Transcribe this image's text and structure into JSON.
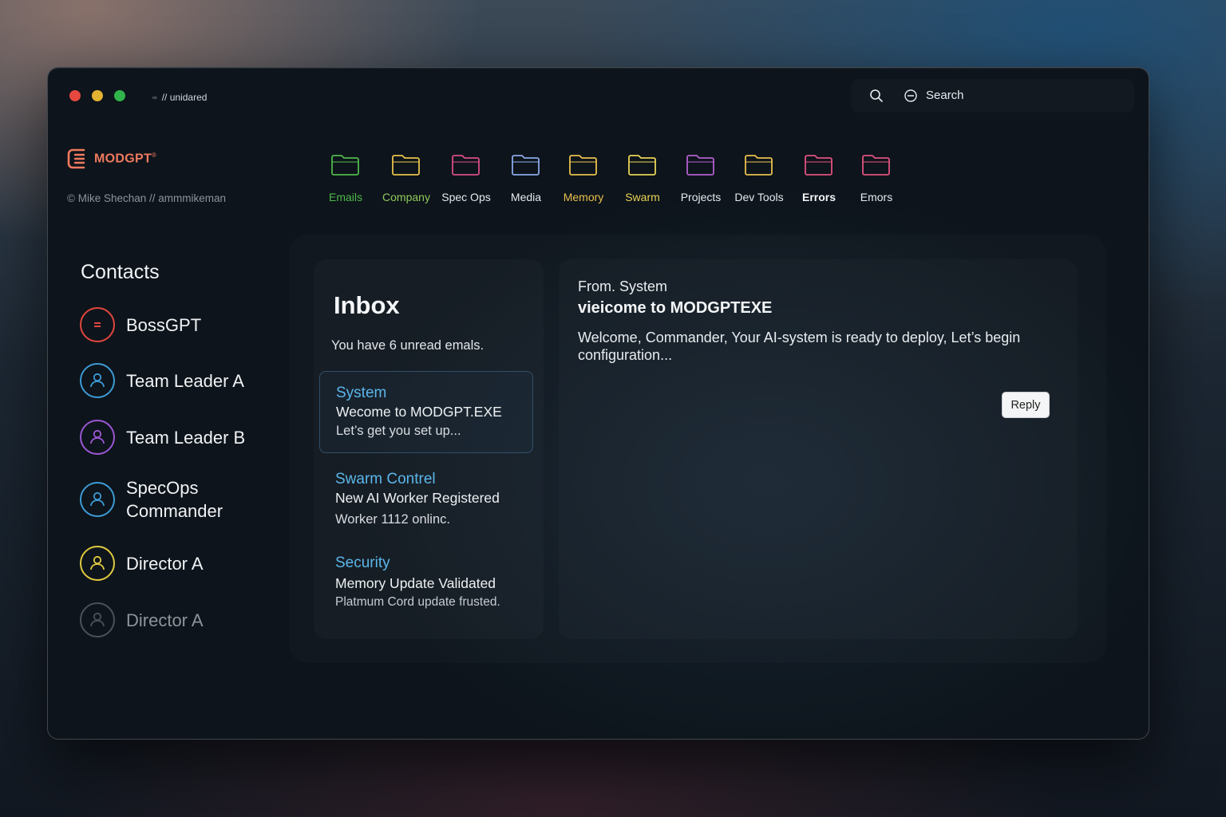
{
  "window": {
    "title": "// unidared",
    "link_glyph": "∞",
    "search_label": "Search"
  },
  "brand": {
    "name": "MODGPT",
    "trademark": "®",
    "credit": "© Mike Shechan // ammmikeman"
  },
  "folders": [
    {
      "label": "Emails",
      "color": "#4fb84a",
      "label_color": "#4fb84a"
    },
    {
      "label": "Company",
      "color": "#e7c24a",
      "label_color": "#8fc85a"
    },
    {
      "label": "Spec Ops",
      "color": "#d94d86",
      "label_color": "#e6eaee"
    },
    {
      "label": "Media",
      "color": "#8aa8e8",
      "label_color": "#e6eaee"
    },
    {
      "label": "Memory",
      "color": "#e8c04e",
      "label_color": "#e8c04e"
    },
    {
      "label": "Swarm",
      "color": "#e8d256",
      "label_color": "#e8d256"
    },
    {
      "label": "Projects",
      "color": "#b35fcf",
      "label_color": "#e6eaee"
    },
    {
      "label": "Dev Tools",
      "color": "#e8c04e",
      "label_color": "#e6eaee"
    },
    {
      "label": "Errors",
      "color": "#e0527f",
      "label_color": "#f2f4f6"
    },
    {
      "label": "Emors",
      "color": "#e0527f",
      "label_color": "#e6eaee"
    }
  ],
  "contacts": {
    "title": "Contacts",
    "items": [
      {
        "name": "BossGPT",
        "color": "#e0463e",
        "icon": "equals-icon"
      },
      {
        "name": "Team Leader A",
        "color": "#3d9bd6",
        "icon": "user-icon"
      },
      {
        "name": "Team Leader B",
        "color": "#9b57d4",
        "icon": "user-icon"
      },
      {
        "name": "SpecOps Commander",
        "color": "#3d9bd6",
        "icon": "user-icon"
      },
      {
        "name": "Director A",
        "color": "#e0c940",
        "icon": "user-icon"
      },
      {
        "name": "Director A",
        "color": "#4b5157",
        "icon": "user-icon"
      }
    ]
  },
  "inbox": {
    "title": "Inbox",
    "subtitle": "You have 6 unread emals.",
    "messages": [
      {
        "sender": "System",
        "subject": "Wecome to MODGPT.EXE",
        "preview": "Let’s get you set up..."
      },
      {
        "sender": "Swarm Contrel",
        "subject": "New AI Worker Registered",
        "preview": "Worker 1112 onlinc."
      },
      {
        "sender": "Security",
        "subject": "Memory Update Validated",
        "preview": "Platmum Cord update frusted."
      }
    ]
  },
  "reader": {
    "from": "From. System",
    "subject": "vieicome to MODGPTEXE",
    "body": "Welcome, Commander, Your  AI-system is ready to deploy, Let’s begin configuration...",
    "reply_label": "Reply"
  }
}
